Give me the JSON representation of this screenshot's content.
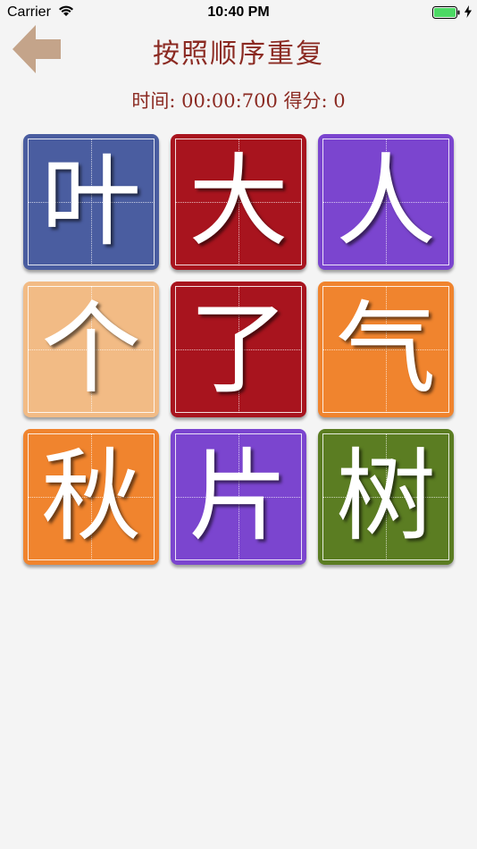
{
  "status_bar": {
    "carrier": "Carrier",
    "time": "10:40 PM"
  },
  "header": {
    "title": "按照顺序重复",
    "back_icon": "back-arrow-icon"
  },
  "stats": {
    "time_label": "时间:",
    "time_value": "00:00:700",
    "score_label": "得分:",
    "score_value": "0"
  },
  "tiles": [
    {
      "char": "叶",
      "color": "#4a5da0"
    },
    {
      "char": "大",
      "color": "#a8141e"
    },
    {
      "char": "人",
      "color": "#7b45cf"
    },
    {
      "char": "个",
      "color": "#f2bb85"
    },
    {
      "char": "了",
      "color": "#a8141e"
    },
    {
      "char": "气",
      "color": "#f0842e"
    },
    {
      "char": "秋",
      "color": "#f0842e"
    },
    {
      "char": "片",
      "color": "#7b45cf"
    },
    {
      "char": "树",
      "color": "#5b7d22"
    }
  ]
}
